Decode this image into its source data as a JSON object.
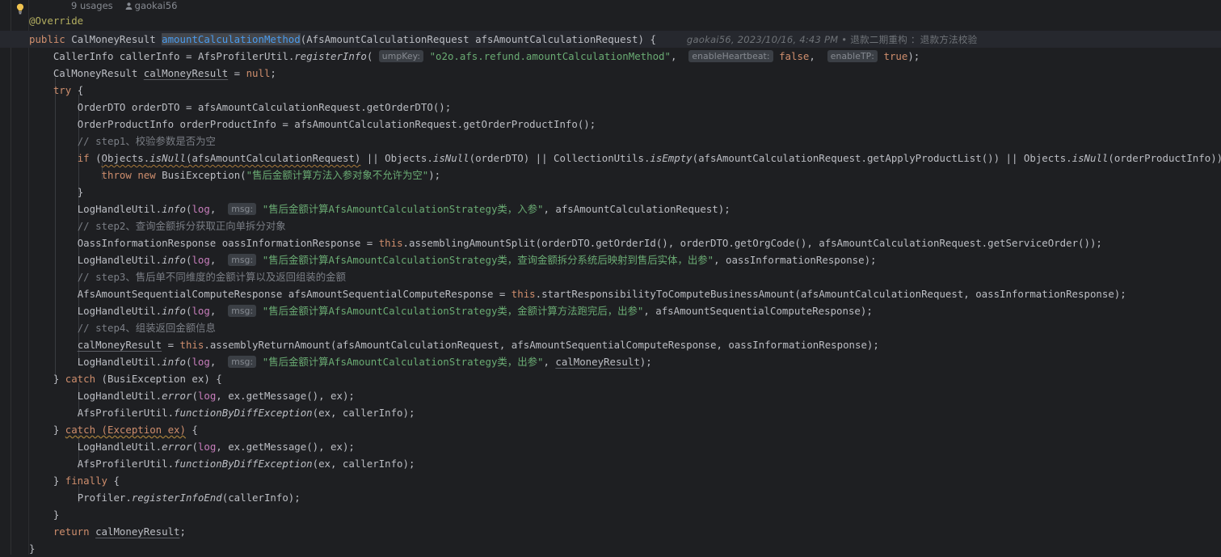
{
  "editor": {
    "theme_bg": "#1e1f22",
    "default_fg": "#bcbec4",
    "highlight_line_bg": "#26282e",
    "selection_bg": "#43454a",
    "language": "Java"
  },
  "usage_bar": {
    "usages": "9 usages",
    "author_icon": "person-icon",
    "author": "gaokai56"
  },
  "gutter": {
    "intention_bulb_icon": "lightbulb-icon"
  },
  "blame": {
    "author": "gaokai56",
    "date": "2023/10/16",
    "time": "4:43 PM",
    "separator": "•",
    "branch": "退款二期重构",
    "colon": "：",
    "message": "退款方法校验"
  },
  "hints": {
    "ump_key": "umpKey:",
    "enable_heartbeat": "enableHeartbeat:",
    "enable_tp": "enableTP:",
    "msg": "msg:"
  },
  "code": {
    "annotation": "@Override",
    "sig": {
      "modifier": "public",
      "return_type": "CalMoneyResult",
      "method_name": "amountCalculationMethod",
      "paren_open": "(",
      "param_type": "AfsAmountCalculationRequest",
      "param_name": "afsAmountCalculationRequest",
      "paren_close": ")",
      "brace": "{"
    },
    "l_caller": {
      "type": "CallerInfo",
      "var": "callerInfo",
      "eq": "=",
      "call": "AfsProfilerUtil.",
      "method": "registerInfo",
      "open": "(",
      "umpkey_val": "\"o2o.afs.refund.amountCalculationMethod\"",
      "comma1": ",",
      "heartbeat_val": "false",
      "comma2": ",",
      "tp_val": "true",
      "close": ");"
    },
    "l_result_decl": "CalMoneyResult calMoneyResult = null;",
    "l_try": "try {",
    "l_orderdto": "OrderDTO orderDTO = afsAmountCalculationRequest.getOrderDTO();",
    "l_orderproduct": "OrderProductInfo orderProductInfo = afsAmountCalculationRequest.getOrderProductInfo();",
    "c_step1": "// step1、校验参数是否为空",
    "l_if_a": "if (",
    "l_if_cond1": "Objects.isNull(afsAmountCalculationRequest)",
    "l_if_rest": " || Objects.isNull(orderDTO) || CollectionUtils.isEmpty(afsAmountCalculationRequest.getApplyProductList()) || Objects.isNull(orderProductInfo)) {",
    "l_throw_pre": "throw new BusiException(",
    "l_throw_str": "\"售后金额计算方法入参对象不允许为空\"",
    "l_throw_post": ");",
    "l_brace_close": "}",
    "l_log1_str": "\"售后金额计算AfsAmountCalculationStrategy类，入参\"",
    "l_log1_tail": ", afsAmountCalculationRequest);",
    "c_step2": "// step2、查询金额拆分获取正向单拆分对象",
    "l_oass": "OassInformationResponse oassInformationResponse = ",
    "l_oass_this": "this",
    "l_oass_tail": ".assemblingAmountSplit(orderDTO.getOrderId(), orderDTO.getOrgCode(), afsAmountCalculationRequest.getServiceOrder());",
    "l_log2_str": "\"售后金额计算AfsAmountCalculationStrategy类，查询金额拆分系统后映射到售后实体，出参\"",
    "l_log2_tail": ", oassInformationResponse);",
    "c_step3": "// step3、售后单不同维度的金额计算以及返回组装的金额",
    "l_seq": "AfsAmountSequentialComputeResponse afsAmountSequentialComputeResponse = ",
    "l_seq_tail": ".startResponsibilityToComputeBusinessAmount(afsAmountCalculationRequest, oassInformationResponse);",
    "l_log3_str": "\"售后金额计算AfsAmountCalculationStrategy类，金额计算方法跑完后，出参\"",
    "l_log3_tail": ", afsAmountSequentialComputeResponse);",
    "c_step4": "// step4、组装返回金额信息",
    "l_assembly_var": "calMoneyResult",
    "l_assembly_eq": " = ",
    "l_assembly_tail": ".assemblyReturnAmount(afsAmountCalculationRequest, afsAmountSequentialComputeResponse, oassInformationResponse);",
    "l_log4_str": "\"售后金额计算AfsAmountCalculationStrategy类，出参\"",
    "l_log4_var": "calMoneyResult",
    "l_log4_tail": ");",
    "l_catch_busi_a": "} ",
    "l_catch_busi_kw": "catch",
    "l_catch_busi_b": " (BusiException ex) {",
    "l_logerr_pre": "LogHandleUtil.",
    "l_logerr_m": "error",
    "l_logerr_open": "(",
    "l_logerr_log": "log",
    "l_logerr_tail": ", ex.getMessage(), ex);",
    "l_profiler_pre": "AfsProfilerUtil.",
    "l_profiler_m": "functionByDiffException",
    "l_profiler_tail": "(ex, callerInfo);",
    "l_catch_exc_kw": "catch (Exception ex)",
    "l_catch_exc_tail": " {",
    "l_finally": "} finally {",
    "l_profiler2_pre": "Profiler.",
    "l_profiler2_m": "registerInfoEnd",
    "l_profiler2_tail": "(callerInfo);",
    "l_return_kw": "return ",
    "l_return_var": "calMoneyResult",
    "l_return_semi": ";",
    "l_final_brace": "}",
    "l_loghandle_pre": "LogHandleUtil.",
    "l_loghandle_m": "info",
    "l_loghandle_open": "(",
    "l_loghandle_log": "log",
    "l_loghandle_comma": ", "
  }
}
